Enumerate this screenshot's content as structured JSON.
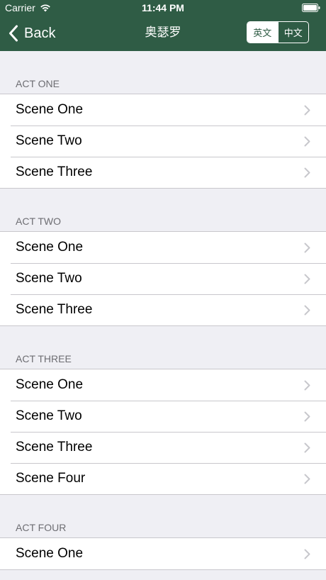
{
  "status_bar": {
    "carrier": "Carrier",
    "time": "11:44 PM"
  },
  "nav": {
    "back_label": "Back",
    "title": "奥瑟罗",
    "segments": [
      "英文",
      "中文"
    ],
    "selected_segment": "英文"
  },
  "colors": {
    "nav_background": "#2f5c45",
    "table_background": "#efeff4",
    "separator": "#c8c7cc",
    "section_header_text": "#6d6d72",
    "chevron": "#c7c7cc"
  },
  "sections": [
    {
      "title": "ACT ONE",
      "rows": [
        "Scene One",
        "Scene Two",
        "Scene Three"
      ]
    },
    {
      "title": "ACT TWO",
      "rows": [
        "Scene One",
        "Scene Two",
        "Scene Three"
      ]
    },
    {
      "title": "ACT THREE",
      "rows": [
        "Scene One",
        "Scene Two",
        "Scene Three",
        "Scene Four"
      ]
    },
    {
      "title": "ACT FOUR",
      "rows": [
        "Scene One"
      ]
    }
  ]
}
